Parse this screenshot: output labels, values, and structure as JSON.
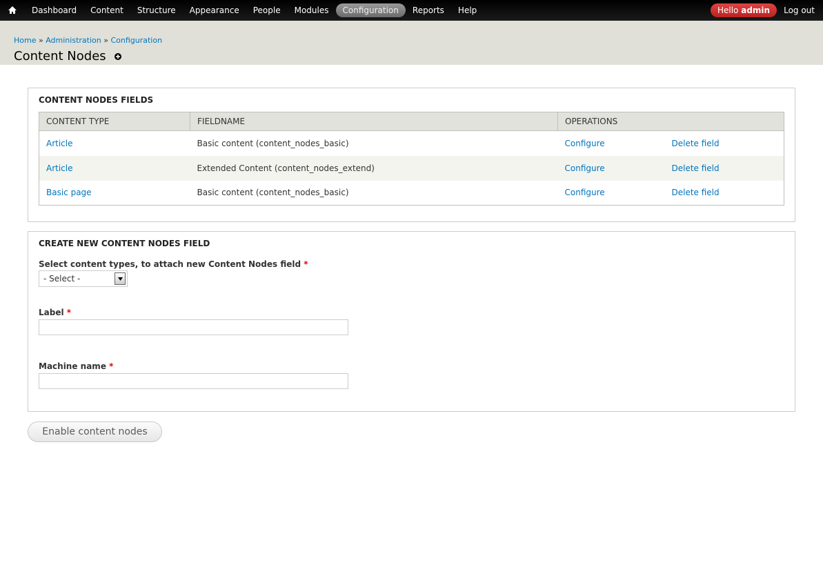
{
  "toolbar": {
    "home_icon": "home-icon",
    "menu": [
      {
        "label": "Dashboard"
      },
      {
        "label": "Content"
      },
      {
        "label": "Structure"
      },
      {
        "label": "Appearance"
      },
      {
        "label": "People"
      },
      {
        "label": "Modules"
      },
      {
        "label": "Configuration",
        "active": true
      },
      {
        "label": "Reports"
      },
      {
        "label": "Help"
      }
    ],
    "hello_prefix": "Hello",
    "username": "admin",
    "logout": "Log out"
  },
  "header": {
    "breadcrumb": [
      "Home",
      "Administration",
      "Configuration"
    ],
    "breadcrumb_sep": "»",
    "title": "Content Nodes"
  },
  "fields_section": {
    "legend": "CONTENT NODES FIELDS",
    "columns": [
      "CONTENT TYPE",
      "FIELDNAME",
      "OPERATIONS"
    ],
    "rows": [
      {
        "content_type": "Article",
        "fieldname": "Basic content (content_nodes_basic)",
        "op1": "Configure",
        "op2": "Delete field"
      },
      {
        "content_type": "Article",
        "fieldname": "Extended Content (content_nodes_extend)",
        "op1": "Configure",
        "op2": "Delete field"
      },
      {
        "content_type": "Basic page",
        "fieldname": "Basic content (content_nodes_basic)",
        "op1": "Configure",
        "op2": "Delete field"
      }
    ]
  },
  "create_section": {
    "legend": "CREATE NEW CONTENT NODES FIELD",
    "select_label": "Select content types, to attach new Content Nodes field",
    "select_value": "- Select -",
    "label_label": "Label",
    "label_value": "",
    "machine_label": "Machine name",
    "machine_value": "",
    "required_mark": "*"
  },
  "submit_button": "Enable content nodes"
}
